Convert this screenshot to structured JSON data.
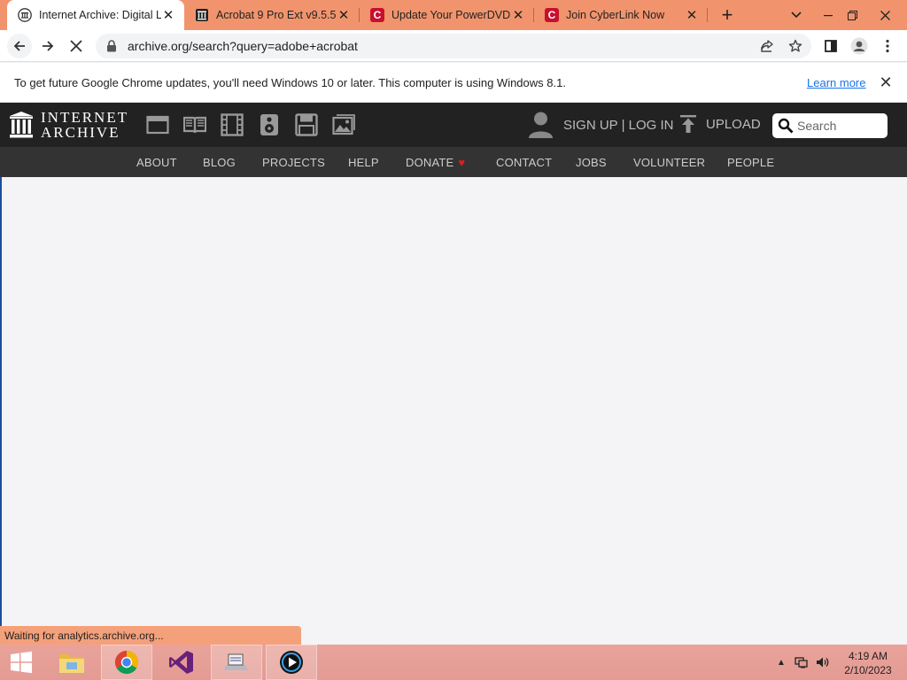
{
  "browser": {
    "tabs": [
      {
        "title": "Internet Archive: Digital Library",
        "active": true,
        "favicon": "internet-archive-icon"
      },
      {
        "title": "Acrobat 9 Pro Ext v9.5.5",
        "active": false,
        "favicon": "internet-archive-icon"
      },
      {
        "title": "Update Your PowerDVD",
        "active": false,
        "favicon": "cyberlink-icon"
      },
      {
        "title": "Join CyberLink Now",
        "active": false,
        "favicon": "cyberlink-icon"
      }
    ],
    "favicon_letter": "C",
    "url": "archive.org/search?query=adobe+acrobat",
    "infobar": {
      "message": "To get future Google Chrome updates, you'll need Windows 10 or later. This computer is using Windows 8.1.",
      "link": "Learn more"
    },
    "status_text": "Waiting for analytics.archive.org...",
    "colors": {
      "tabstrip": "#f1946d",
      "link": "#1a73e8"
    }
  },
  "site": {
    "logo_line1": "INTERNET",
    "logo_line2": "ARCHIVE",
    "media_icons": [
      "web-icon",
      "texts-icon",
      "video-icon",
      "audio-icon",
      "software-icon",
      "images-icon"
    ],
    "account_label": "SIGN UP | LOG IN",
    "upload_label": "UPLOAD",
    "search_placeholder": "Search",
    "nav": [
      "ABOUT",
      "BLOG",
      "PROJECTS",
      "HELP",
      "DONATE",
      "CONTACT",
      "JOBS",
      "VOLUNTEER",
      "PEOPLE"
    ],
    "colors": {
      "header": "#222222",
      "nav": "#333333",
      "heart": "#e21b1b"
    }
  },
  "taskbar": {
    "apps": [
      "file-explorer-icon",
      "chrome-icon",
      "visual-studio-icon",
      "scanner-icon",
      "powerdvd-icon"
    ],
    "time": "4:19 AM",
    "date": "2/10/2023"
  }
}
